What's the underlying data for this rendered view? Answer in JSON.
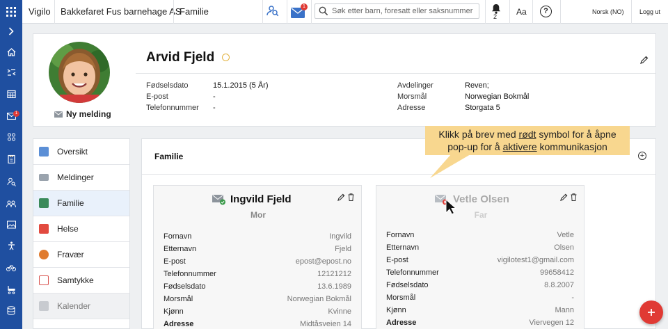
{
  "app": {
    "name": "Vigilo",
    "institution": "Bakkefaret Fus barnehage AS",
    "section": "Familie"
  },
  "topbar": {
    "message_badge": "1",
    "search_placeholder": "Søk etter barn, foresatt eller saksnummer",
    "bell_count": "2",
    "font_size_label": "Aa",
    "help_label": "?",
    "language": "Norsk (NO)",
    "logout": "Logg ut"
  },
  "sidebar": {
    "message_badge": "1",
    "icons": [
      "chevron-right-icon",
      "home-icon",
      "checkin-icon",
      "calendar-icon",
      "mail-icon",
      "groups-icon",
      "clipboard-icon",
      "person-search-icon",
      "group-icon",
      "image-icon",
      "accessibility-icon",
      "bike-icon",
      "stroller-icon",
      "database-icon"
    ]
  },
  "profile": {
    "name": "Arvid Fjeld",
    "new_message": "Ny melding",
    "fields_left": [
      {
        "label": "Fødselsdato",
        "value": "15.1.2015 (5 År)"
      },
      {
        "label": "E-post",
        "value": "-"
      },
      {
        "label": "Telefonnummer",
        "value": "-"
      }
    ],
    "fields_right": [
      {
        "label": "Avdelinger",
        "value": "Reven;"
      },
      {
        "label": "Morsmål",
        "value": "Norwegian Bokmål"
      },
      {
        "label": "Adresse",
        "value": "Storgata 5"
      }
    ]
  },
  "nav": {
    "items": [
      {
        "label": "Oversikt",
        "color": "#5b8fd6"
      },
      {
        "label": "Meldinger",
        "color": "#9aa3ad"
      },
      {
        "label": "Familie",
        "color": "#3a8a5a"
      },
      {
        "label": "Helse",
        "color": "#e24a3f"
      },
      {
        "label": "Fravær",
        "color": "#e07b2e"
      },
      {
        "label": "Samtykke",
        "color": "#d9534f"
      },
      {
        "label": "Kalender",
        "color": "#c8cbd0"
      }
    ]
  },
  "family": {
    "title": "Familie",
    "tooltip": {
      "line1_pre": "Klikk på brev med ",
      "line1_u": "rødt",
      "line1_post": " symbol for å åpne",
      "line2_pre": "pop-up for å ",
      "line2_u": "aktivere",
      "line2_post": " kommunikasjon"
    },
    "parents": [
      {
        "name": "Ingvild Fjeld",
        "role": "Mor",
        "rows": [
          {
            "k": "Fornavn",
            "v": "Ingvild"
          },
          {
            "k": "Etternavn",
            "v": "Fjeld"
          },
          {
            "k": "E-post",
            "v": "epost@epost.no"
          },
          {
            "k": "Telefonnummer",
            "v": "12121212"
          },
          {
            "k": "Fødselsdato",
            "v": "13.6.1989"
          },
          {
            "k": "Morsmål",
            "v": "Norwegian Bokmål"
          },
          {
            "k": "Kjønn",
            "v": "Kvinne"
          },
          {
            "k": "Adresse",
            "v": "Midtåsveien 14"
          }
        ]
      },
      {
        "name": "Vetle Olsen",
        "role": "Far",
        "rows": [
          {
            "k": "Fornavn",
            "v": "Vetle"
          },
          {
            "k": "Etternavn",
            "v": "Olsen"
          },
          {
            "k": "E-post",
            "v": "vigilotest1@gmail.com"
          },
          {
            "k": "Telefonnummer",
            "v": "99658412"
          },
          {
            "k": "Fødselsdato",
            "v": "8.8.2007"
          },
          {
            "k": "Morsmål",
            "v": "-"
          },
          {
            "k": "Kjønn",
            "v": "Mann"
          },
          {
            "k": "Adresse",
            "v": "Viervegen 12"
          }
        ]
      }
    ]
  },
  "colors": {
    "brand_blue": "#1f4fa0",
    "accent_red": "#e03a34",
    "tooltip_bg": "#f8d78f",
    "active_nav": "#e9f1fb"
  }
}
